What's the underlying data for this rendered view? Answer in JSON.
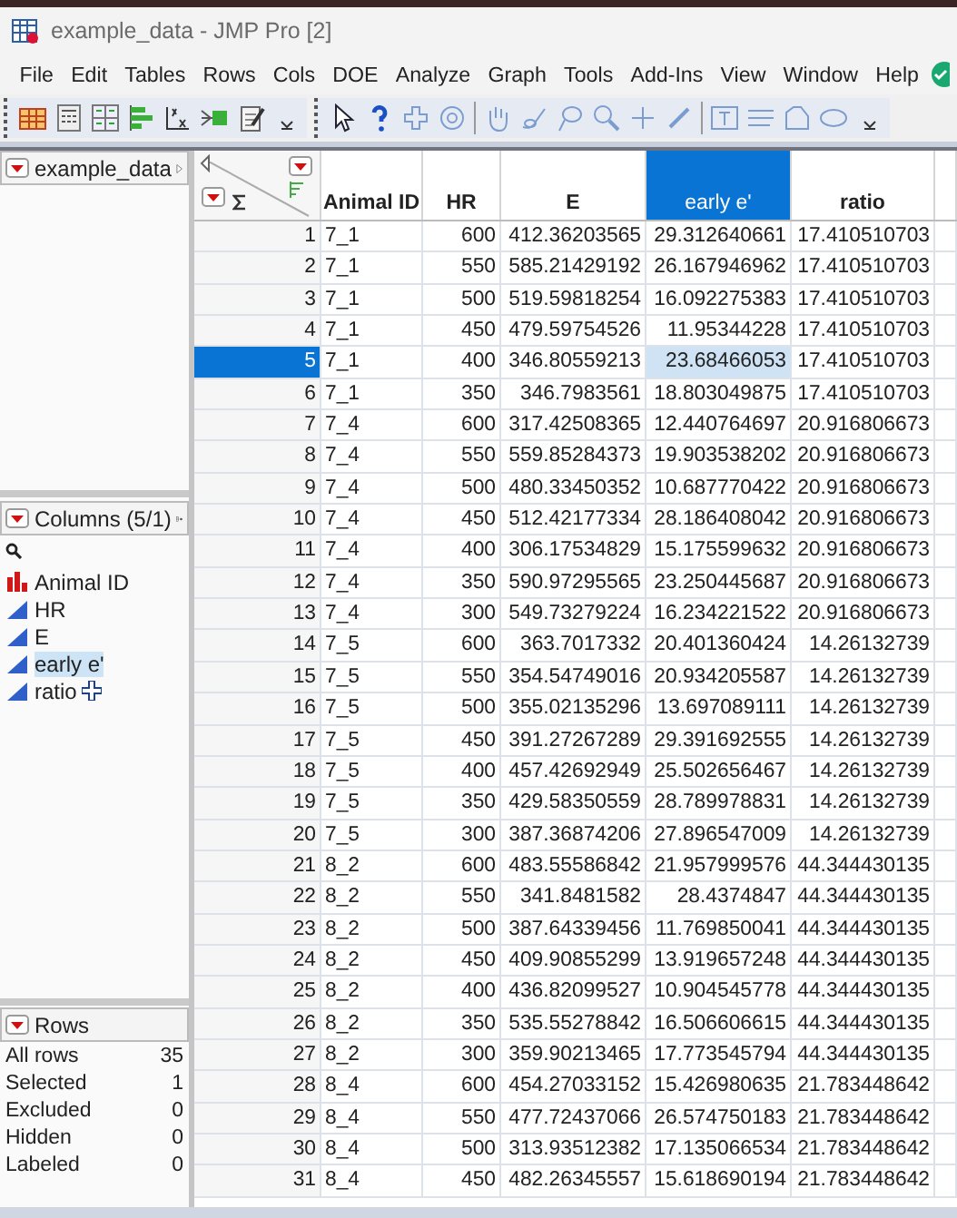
{
  "window": {
    "title": "example_data - JMP Pro [2]"
  },
  "menu": [
    "File",
    "Edit",
    "Tables",
    "Rows",
    "Cols",
    "DOE",
    "Analyze",
    "Graph",
    "Tools",
    "Add-Ins",
    "View",
    "Window",
    "Help"
  ],
  "table_panel": {
    "name": "example_data"
  },
  "columns_panel": {
    "title": "Columns (5/1)",
    "items": [
      {
        "name": "Animal ID",
        "kind": "nominal",
        "selected": false
      },
      {
        "name": "HR",
        "kind": "continuous",
        "selected": false
      },
      {
        "name": "E",
        "kind": "continuous",
        "selected": false
      },
      {
        "name": "early e'",
        "kind": "continuous",
        "selected": true
      },
      {
        "name": "ratio",
        "kind": "continuous",
        "selected": false
      }
    ]
  },
  "rows_panel": {
    "title": "Rows",
    "items": [
      {
        "label": "All rows",
        "value": "35"
      },
      {
        "label": "Selected",
        "value": "1"
      },
      {
        "label": "Excluded",
        "value": "0"
      },
      {
        "label": "Hidden",
        "value": "0"
      },
      {
        "label": "Labeled",
        "value": "0"
      }
    ]
  },
  "table": {
    "columns": [
      {
        "label": "Animal ID",
        "kind": "character",
        "selected": false
      },
      {
        "label": "HR",
        "kind": "numeric",
        "selected": false
      },
      {
        "label": "E",
        "kind": "numeric",
        "selected": false
      },
      {
        "label": "early e'",
        "kind": "numeric",
        "selected": true
      },
      {
        "label": "ratio",
        "kind": "numeric",
        "selected": false
      }
    ],
    "rows": [
      {
        "number": "1",
        "selected": false,
        "cells": [
          "7_1",
          "600",
          "412.36203565",
          "29.312640661",
          "17.410510703"
        ]
      },
      {
        "number": "2",
        "selected": false,
        "cells": [
          "7_1",
          "550",
          "585.21429192",
          "26.167946962",
          "17.410510703"
        ]
      },
      {
        "number": "3",
        "selected": false,
        "cells": [
          "7_1",
          "500",
          "519.59818254",
          "16.092275383",
          "17.410510703"
        ]
      },
      {
        "number": "4",
        "selected": false,
        "cells": [
          "7_1",
          "450",
          "479.59754526",
          "11.95344228",
          "17.410510703"
        ]
      },
      {
        "number": "5",
        "selected": true,
        "cells": [
          "7_1",
          "400",
          "346.80559213",
          "23.68466053",
          "17.410510703"
        ]
      },
      {
        "number": "6",
        "selected": false,
        "cells": [
          "7_1",
          "350",
          "346.7983561",
          "18.803049875",
          "17.410510703"
        ]
      },
      {
        "number": "7",
        "selected": false,
        "cells": [
          "7_4",
          "600",
          "317.42508365",
          "12.440764697",
          "20.916806673"
        ]
      },
      {
        "number": "8",
        "selected": false,
        "cells": [
          "7_4",
          "550",
          "559.85284373",
          "19.903538202",
          "20.916806673"
        ]
      },
      {
        "number": "9",
        "selected": false,
        "cells": [
          "7_4",
          "500",
          "480.33450352",
          "10.687770422",
          "20.916806673"
        ]
      },
      {
        "number": "10",
        "selected": false,
        "cells": [
          "7_4",
          "450",
          "512.42177334",
          "28.186408042",
          "20.916806673"
        ]
      },
      {
        "number": "11",
        "selected": false,
        "cells": [
          "7_4",
          "400",
          "306.17534829",
          "15.175599632",
          "20.916806673"
        ]
      },
      {
        "number": "12",
        "selected": false,
        "cells": [
          "7_4",
          "350",
          "590.97295565",
          "23.250445687",
          "20.916806673"
        ]
      },
      {
        "number": "13",
        "selected": false,
        "cells": [
          "7_4",
          "300",
          "549.73279224",
          "16.234221522",
          "20.916806673"
        ]
      },
      {
        "number": "14",
        "selected": false,
        "cells": [
          "7_5",
          "600",
          "363.7017332",
          "20.401360424",
          "14.26132739"
        ]
      },
      {
        "number": "15",
        "selected": false,
        "cells": [
          "7_5",
          "550",
          "354.54749016",
          "20.934205587",
          "14.26132739"
        ]
      },
      {
        "number": "16",
        "selected": false,
        "cells": [
          "7_5",
          "500",
          "355.02135296",
          "13.697089111",
          "14.26132739"
        ]
      },
      {
        "number": "17",
        "selected": false,
        "cells": [
          "7_5",
          "450",
          "391.27267289",
          "29.391692555",
          "14.26132739"
        ]
      },
      {
        "number": "18",
        "selected": false,
        "cells": [
          "7_5",
          "400",
          "457.42692949",
          "25.502656467",
          "14.26132739"
        ]
      },
      {
        "number": "19",
        "selected": false,
        "cells": [
          "7_5",
          "350",
          "429.58350559",
          "28.789978831",
          "14.26132739"
        ]
      },
      {
        "number": "20",
        "selected": false,
        "cells": [
          "7_5",
          "300",
          "387.36874206",
          "27.896547009",
          "14.26132739"
        ]
      },
      {
        "number": "21",
        "selected": false,
        "cells": [
          "8_2",
          "600",
          "483.55586842",
          "21.957999576",
          "44.344430135"
        ]
      },
      {
        "number": "22",
        "selected": false,
        "cells": [
          "8_2",
          "550",
          "341.8481582",
          "28.4374847",
          "44.344430135"
        ]
      },
      {
        "number": "23",
        "selected": false,
        "cells": [
          "8_2",
          "500",
          "387.64339456",
          "11.769850041",
          "44.344430135"
        ]
      },
      {
        "number": "24",
        "selected": false,
        "cells": [
          "8_2",
          "450",
          "409.90855299",
          "13.919657248",
          "44.344430135"
        ]
      },
      {
        "number": "25",
        "selected": false,
        "cells": [
          "8_2",
          "400",
          "436.82099527",
          "10.904545778",
          "44.344430135"
        ]
      },
      {
        "number": "26",
        "selected": false,
        "cells": [
          "8_2",
          "350",
          "535.55278842",
          "16.506606615",
          "44.344430135"
        ]
      },
      {
        "number": "27",
        "selected": false,
        "cells": [
          "8_2",
          "300",
          "359.90213465",
          "17.773545794",
          "44.344430135"
        ]
      },
      {
        "number": "28",
        "selected": false,
        "cells": [
          "8_4",
          "600",
          "454.27033152",
          "15.426980635",
          "21.783448642"
        ]
      },
      {
        "number": "29",
        "selected": false,
        "cells": [
          "8_4",
          "550",
          "477.72437066",
          "26.574750183",
          "21.783448642"
        ]
      },
      {
        "number": "30",
        "selected": false,
        "cells": [
          "8_4",
          "500",
          "313.93512382",
          "17.135066534",
          "21.783448642"
        ]
      },
      {
        "number": "31",
        "selected": false,
        "cells": [
          "8_4",
          "450",
          "482.26345557",
          "15.618690194",
          "21.783448642"
        ]
      }
    ]
  }
}
